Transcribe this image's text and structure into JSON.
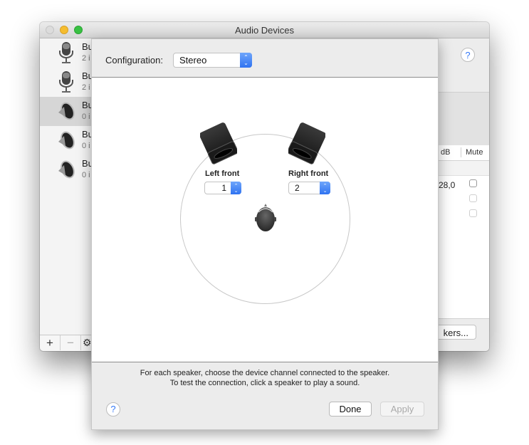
{
  "window": {
    "title": "Audio Devices"
  },
  "sidebar": {
    "devices": [
      {
        "name": "Bu",
        "sub": "2 i",
        "icon": "microphone-icon",
        "selected": false
      },
      {
        "name": "Bu",
        "sub": "2 i",
        "icon": "microphone-icon",
        "selected": false
      },
      {
        "name": "Bu",
        "sub": "0 i",
        "icon": "speaker-icon",
        "selected": true
      },
      {
        "name": "Bu",
        "sub": "0 i",
        "icon": "speaker-icon",
        "selected": false
      },
      {
        "name": "Bu",
        "sub": "0 i",
        "icon": "speaker-icon",
        "selected": false
      }
    ],
    "add_label": "+",
    "remove_label": "−",
    "gear_label": "⚙"
  },
  "right_panel": {
    "help_label": "?",
    "columns": {
      "db": "dB",
      "mute": "Mute"
    },
    "rows": [
      {
        "value": "28,0",
        "mute": false
      },
      {
        "value": "",
        "mute": false
      },
      {
        "value": "",
        "mute": false
      }
    ],
    "configure_button": "kers..."
  },
  "sheet": {
    "config_label": "Configuration:",
    "config_value": "Stereo",
    "speakers": [
      {
        "label": "Left front",
        "channel": "1"
      },
      {
        "label": "Right front",
        "channel": "2"
      }
    ],
    "instructions": [
      "For each speaker, choose the device channel connected to the speaker.",
      "To test the connection, click a speaker to play a sound."
    ],
    "help_label": "?",
    "done_label": "Done",
    "apply_label": "Apply"
  },
  "colors": {
    "accent": "#3478f6",
    "traffic_close": "#dcdcdc",
    "traffic_min": "#f5bd2f",
    "traffic_max": "#39c143"
  }
}
